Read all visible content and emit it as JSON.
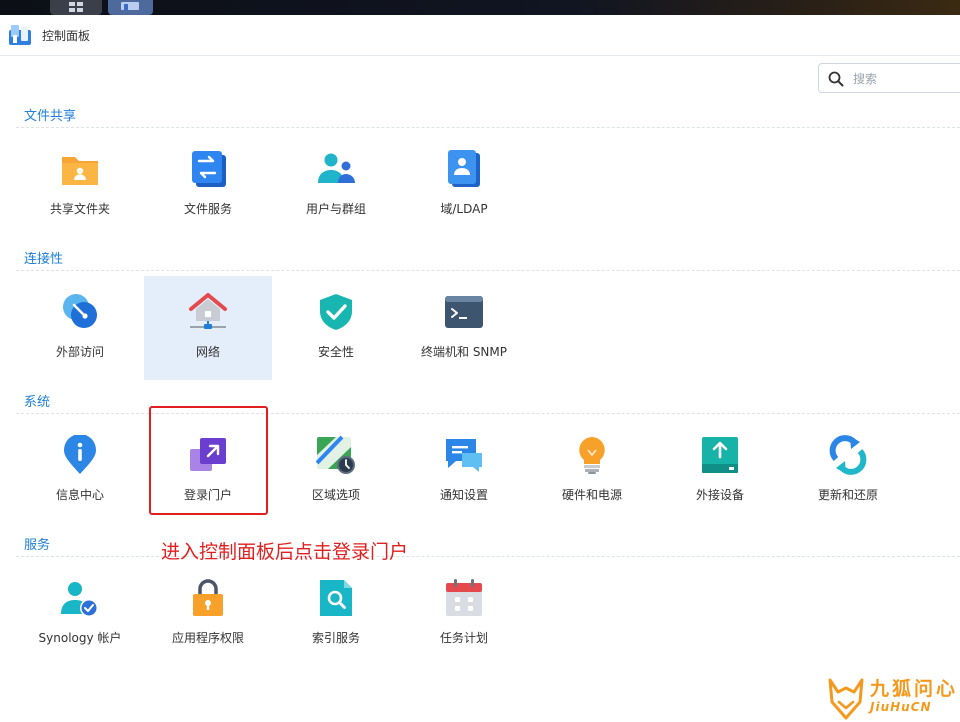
{
  "window": {
    "title": "控制面板"
  },
  "search": {
    "placeholder": "搜索"
  },
  "sections": [
    {
      "title": "文件共享",
      "items": [
        "共享文件夹",
        "文件服务",
        "用户与群组",
        "域/LDAP"
      ]
    },
    {
      "title": "连接性",
      "items": [
        "外部访问",
        "网络",
        "安全性",
        "终端机和 SNMP"
      ]
    },
    {
      "title": "系统",
      "items": [
        "信息中心",
        "登录门户",
        "区域选项",
        "通知设置",
        "硬件和电源",
        "外接设备",
        "更新和还原"
      ]
    },
    {
      "title": "服务",
      "items": [
        "Synology 帐户",
        "应用程序权限",
        "索引服务",
        "任务计划"
      ]
    }
  ],
  "annotation": "进入控制面板后点击登录门户",
  "watermark": {
    "cn": "九狐问心",
    "en": "JiuHuCN"
  },
  "colors": {
    "section_title": "#1f7fd6",
    "annotation": "#e02020",
    "selected_tile": "#e4eefa",
    "watermark": "#f39a1e"
  }
}
